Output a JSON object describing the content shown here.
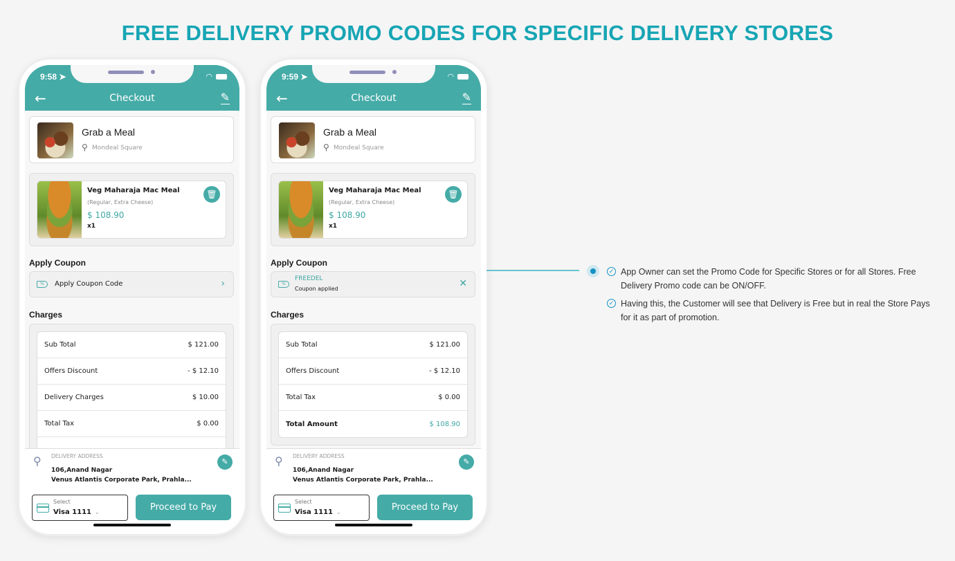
{
  "title": "FREE DELIVERY PROMO CODES FOR SPECIFIC DELIVERY STORES",
  "colors": {
    "accent": "#45aba7",
    "title": "#17a5b4",
    "bullet": "#1592c4"
  },
  "phones": [
    {
      "time": "9:58",
      "nav_title": "Checkout",
      "store": {
        "name": "Grab a Meal",
        "location": "Mondeal Square"
      },
      "item": {
        "name": "Veg Maharaja Mac Meal",
        "options": "(Regular, Extra Cheese)",
        "price": "$ 108.90",
        "qty": "x1"
      },
      "apply_coupon_label": "Apply Coupon",
      "coupon": {
        "placeholder": "Apply Coupon Code"
      },
      "charges_label": "Charges",
      "charges": [
        {
          "label": "Sub Total",
          "value": "$ 121.00"
        },
        {
          "label": "Offers Discount",
          "value": "- $ 12.10"
        },
        {
          "label": "Delivery Charges",
          "value": "$ 10.00"
        },
        {
          "label": "Total Tax",
          "value": "$ 0.00"
        }
      ],
      "address": {
        "label": "DELIVERY ADDRESS",
        "line1": "106,Anand Nagar",
        "line2": "Venus Atlantis Corporate Park, Prahla..."
      },
      "payment": {
        "label": "Select",
        "value": "Visa 1111"
      },
      "proceed_label": "Proceed to Pay"
    },
    {
      "time": "9:59",
      "nav_title": "Checkout",
      "store": {
        "name": "Grab a Meal",
        "location": "Mondeal Square"
      },
      "item": {
        "name": "Veg Maharaja Mac Meal",
        "options": "(Regular, Extra Cheese)",
        "price": "$ 108.90",
        "qty": "x1"
      },
      "apply_coupon_label": "Apply Coupon",
      "coupon": {
        "code": "FREEDEL",
        "status": "Coupon applied"
      },
      "charges_label": "Charges",
      "charges": [
        {
          "label": "Sub Total",
          "value": "$ 121.00"
        },
        {
          "label": "Offers Discount",
          "value": "- $ 12.10"
        },
        {
          "label": "Total Tax",
          "value": "$ 0.00"
        }
      ],
      "total": {
        "label": "Total Amount",
        "value": "$ 108.90"
      },
      "address": {
        "label": "DELIVERY ADDRESS",
        "line1": "106,Anand Nagar",
        "line2": "Venus Atlantis Corporate Park, Prahla..."
      },
      "payment": {
        "label": "Select",
        "value": "Visa 1111"
      },
      "proceed_label": "Proceed to Pay"
    }
  ],
  "features": [
    "App Owner can set the Promo Code for Specific Stores or for all Stores. Free Delivery Promo code can be ON/OFF.",
    "Having this, the Customer will see that Delivery is Free but in real the Store Pays for it as part of promotion."
  ]
}
